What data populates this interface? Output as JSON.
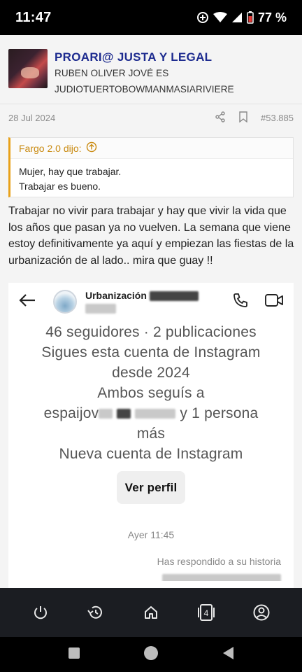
{
  "status": {
    "time": "11:47",
    "battery": "77 %"
  },
  "author": {
    "name": "PROARI@ JUSTA Y LEGAL",
    "signature_line1": "RUBEN OLIVER JOVÉ ES",
    "signature_line2": "JUDIOTUERTOBOWMANMASIARIVIERE"
  },
  "meta": {
    "date": "28 Jul 2024",
    "post_number": "#53.885"
  },
  "quote": {
    "author": "Fargo 2.0 dijo:",
    "line1": "Mujer, hay que trabajar.",
    "line2": "Trabajar es bueno."
  },
  "message": "Trabajar no vivir para trabajar y hay que vivir la vida que los años que pasan ya no vuelven. La semana que viene estoy definitivamente ya aquí y empiezan las fiestas de la urbanización de al lado.. mira que guay !!",
  "screenshot": {
    "title": "Urbanización",
    "stats": "46 seguidores · 2 publicaciones",
    "following_line1": "Sigues esta cuenta de Instagram",
    "following_line2": "desde 2024",
    "mutual_line1": "Ambos seguís a",
    "mutual_prefix": "espaijov",
    "mutual_suffix": "y 1 persona",
    "mutual_line3": "más",
    "new_account": "Nueva cuenta de Instagram",
    "view_profile": "Ver perfil",
    "time": "Ayer 11:45",
    "reply": "Has respondido a su historia"
  },
  "icons": {
    "back": "arrow-left-icon",
    "call": "phone-icon",
    "video": "video-camera-icon",
    "share": "share-icon",
    "bookmark": "bookmark-icon",
    "quote_up": "arrow-up-circle-icon"
  },
  "bottom_nav": {
    "tabs_badge": "4"
  },
  "colors": {
    "author": "#1d2b8f",
    "quote_accent": "#e8a11a"
  }
}
